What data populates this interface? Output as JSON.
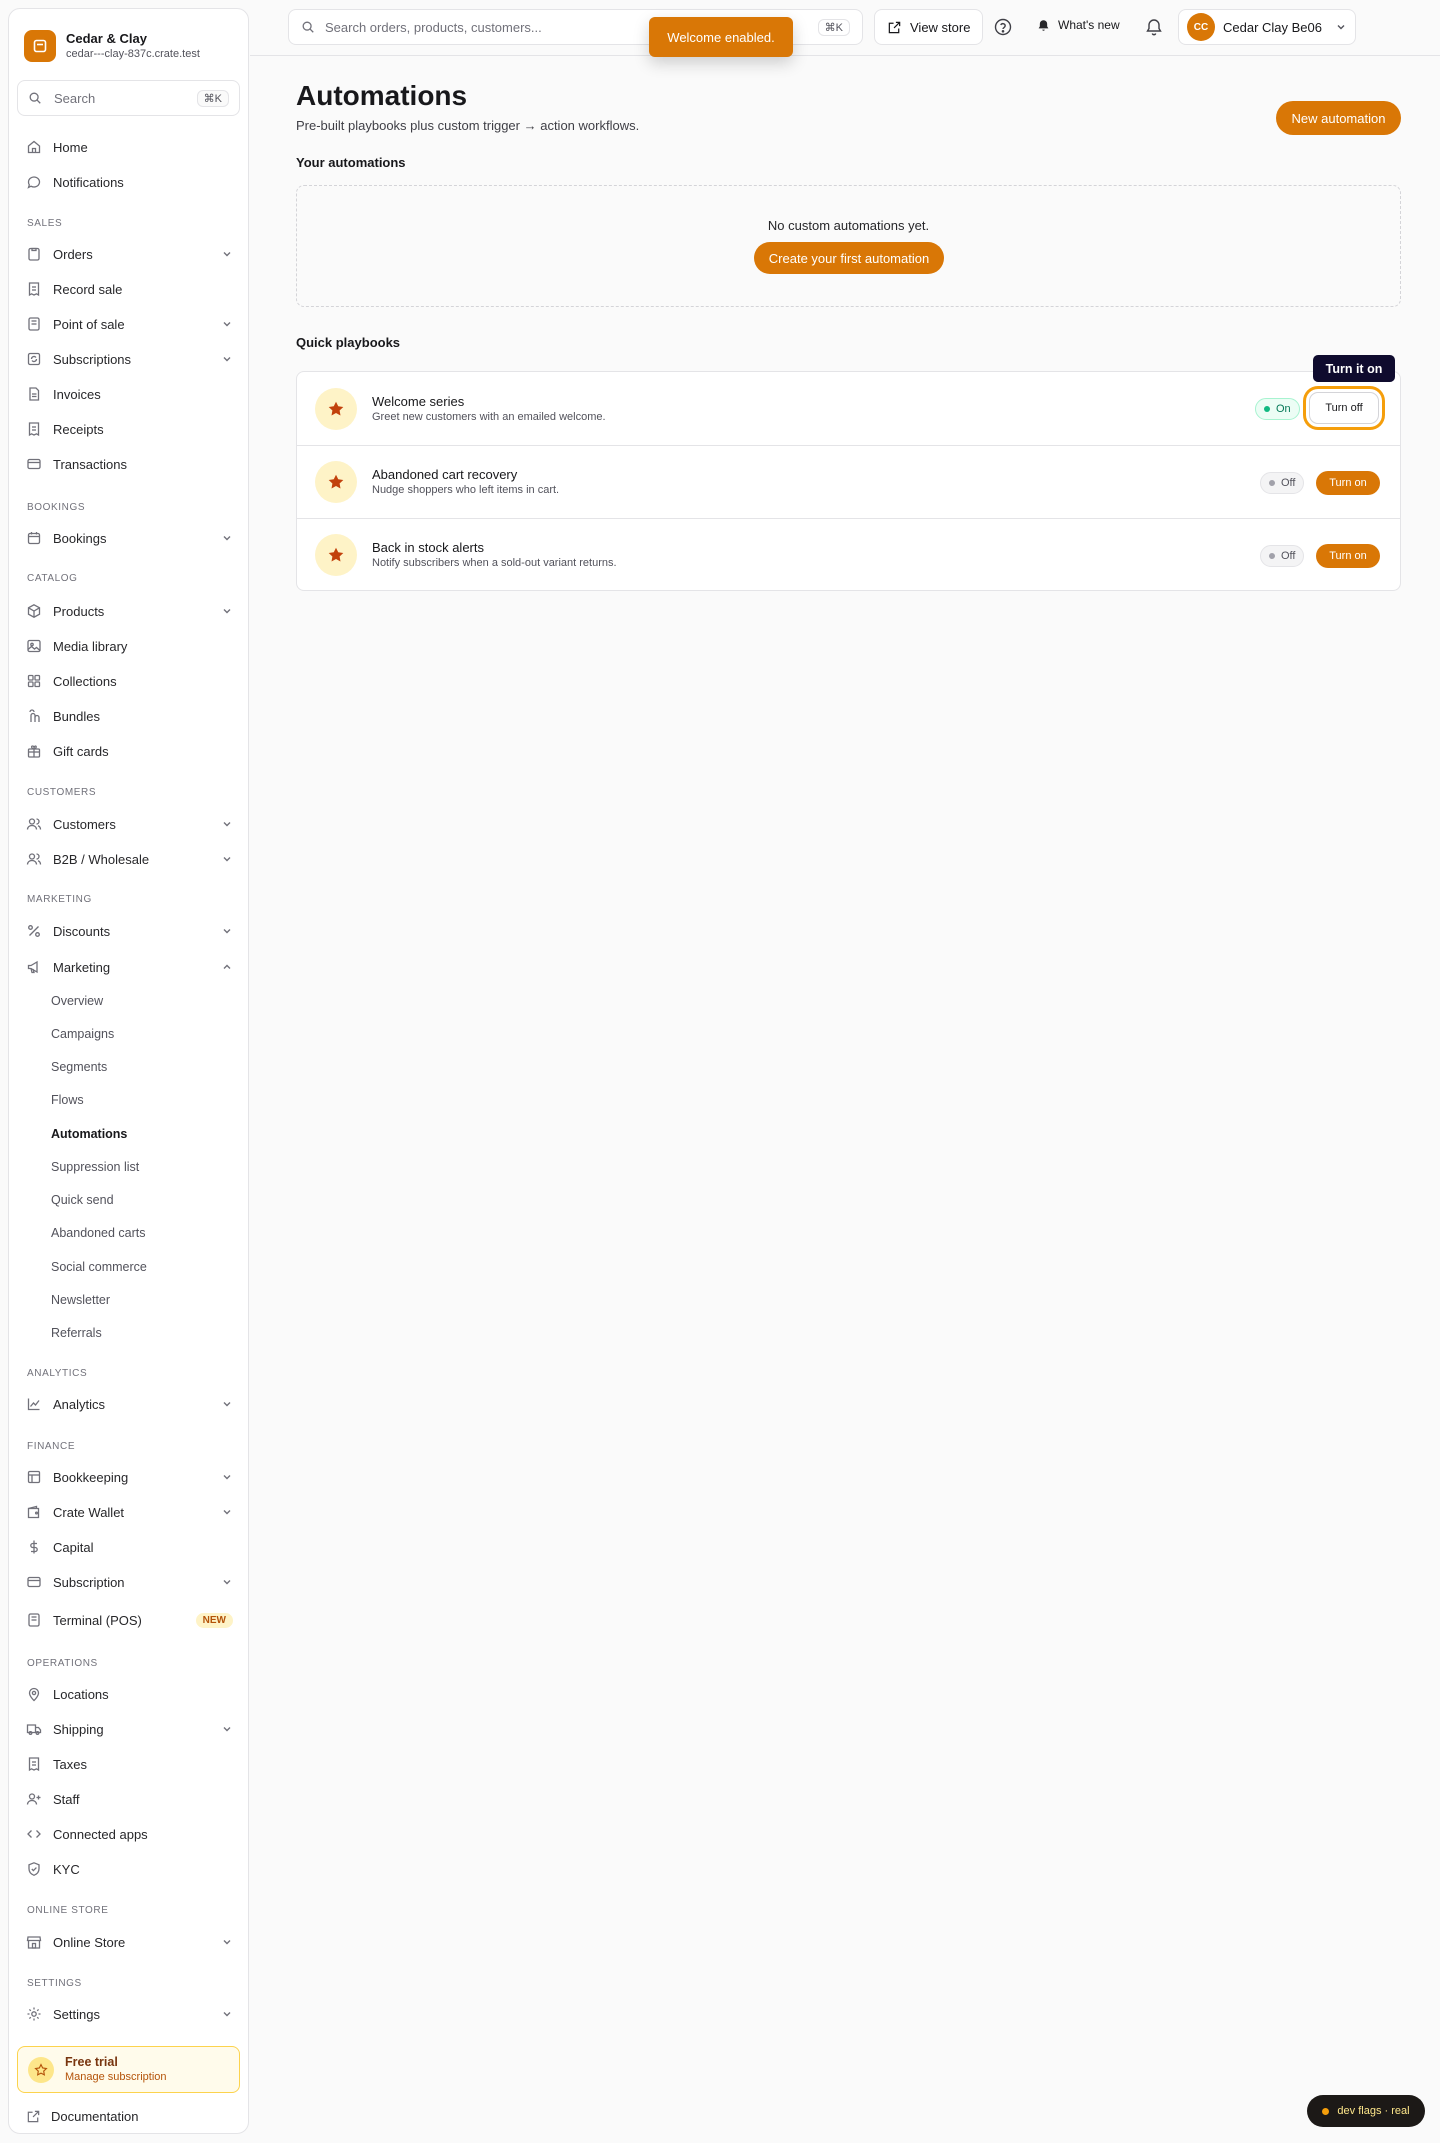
{
  "brand": {
    "name": "Cedar & Clay",
    "domain": "cedar---clay-837c.crate.test"
  },
  "sidebar": {
    "search_label": "Search",
    "search_shortcut": "⌘K",
    "top_items": [
      {
        "label": "Home",
        "icon": "home-icon"
      },
      {
        "label": "Notifications",
        "icon": "chat-bubble-icon"
      }
    ],
    "sections": {
      "sales": "SALES",
      "bookings": "BOOKINGS",
      "catalog": "CATALOG",
      "customers": "CUSTOMERS",
      "marketing": "MARKETING",
      "analytics": "ANALYTICS",
      "finance": "FINANCE",
      "operations": "OPERATIONS",
      "online_store": "ONLINE STORE",
      "settings": "SETTINGS"
    },
    "items": {
      "orders": "Orders",
      "record_sale": "Record sale",
      "point_of_sale": "Point of sale",
      "subscriptions": "Subscriptions",
      "invoices": "Invoices",
      "receipts": "Receipts",
      "transactions": "Transactions",
      "bookings": "Bookings",
      "products": "Products",
      "media_library": "Media library",
      "collections": "Collections",
      "bundles": "Bundles",
      "gift_cards": "Gift cards",
      "customers": "Customers",
      "b2b": "B2B / Wholesale",
      "discounts": "Discounts",
      "marketing": "Marketing",
      "analytics": "Analytics",
      "bookkeeping": "Bookkeeping",
      "crate_wallet": "Crate Wallet",
      "capital": "Capital",
      "subscription": "Subscription",
      "terminal": "Terminal (POS)",
      "terminal_badge": "NEW",
      "locations": "Locations",
      "shipping": "Shipping",
      "taxes": "Taxes",
      "staff": "Staff",
      "connected_apps": "Connected apps",
      "kyc": "KYC",
      "online_store": "Online Store",
      "settings": "Settings"
    },
    "marketing_sub": [
      "Overview",
      "Campaigns",
      "Segments",
      "Flows",
      "Automations",
      "Suppression list",
      "Quick send",
      "Abandoned carts",
      "Social commerce",
      "Newsletter",
      "Referrals"
    ],
    "active_sub": "Automations",
    "trial": {
      "title": "Free trial",
      "subtitle": "Manage subscription"
    },
    "documentation": "Documentation"
  },
  "topbar": {
    "search_placeholder": "Search orders, products, customers...",
    "search_shortcut": "⌘K",
    "view_store": "View store",
    "whats_new": "What's new",
    "user_initials": "CC",
    "user_name": "Cedar Clay Be06"
  },
  "toast": "Welcome enabled.",
  "page": {
    "title": "Automations",
    "subtitle": "Pre-built playbooks plus custom trigger → action workflows.",
    "new_button": "New automation",
    "your_heading": "Your automations",
    "empty_text": "No custom automations yet.",
    "create_first": "Create your first automation",
    "playbooks_heading": "Quick playbooks",
    "playbooks": [
      {
        "name": "Welcome series",
        "desc": "Greet new customers with an emailed welcome.",
        "status": "On",
        "action": "Turn off"
      },
      {
        "name": "Abandoned cart recovery",
        "desc": "Nudge shoppers who left items in cart.",
        "status": "Off",
        "action": "Turn on"
      },
      {
        "name": "Back in stock alerts",
        "desc": "Notify subscribers when a sold-out variant returns.",
        "status": "Off",
        "action": "Turn on"
      }
    ],
    "tooltip": "Turn it on"
  },
  "dev_flags": "dev flags · real",
  "colors": {
    "accent": "#d97706",
    "on": "#10b981",
    "tooltip": "#0f0b2e"
  }
}
